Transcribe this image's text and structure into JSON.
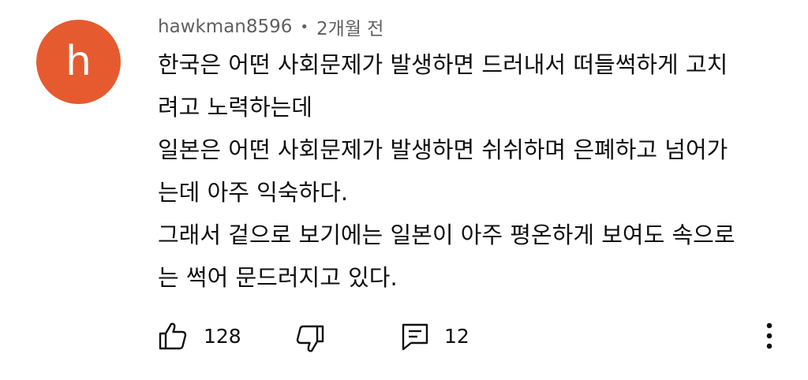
{
  "comment": {
    "avatar_letter": "h",
    "avatar_color": "#e55b2f",
    "author": "hawkman8596",
    "separator": "•",
    "timestamp": "2개월 전",
    "lines": [
      "한국은 어떤 사회문제가 발생하면 드러내서 떠들썩하게 고치",
      "려고 노력하는데",
      "일본은 어떤 사회문제가 발생하면 쉬쉬하며 은폐하고 넘어가",
      "는데 아주 익숙하다.",
      "그래서 겉으로 보기에는 일본이 아주 평온하게 보여도 속으로",
      "는 썩어 문드러지고 있다."
    ]
  },
  "actions": {
    "like_icon": "thumbs-up-icon",
    "like_count": "128",
    "dislike_icon": "thumbs-down-icon",
    "reply_icon": "comment-icon",
    "reply_count": "12",
    "more_icon": "more-vertical-icon"
  }
}
